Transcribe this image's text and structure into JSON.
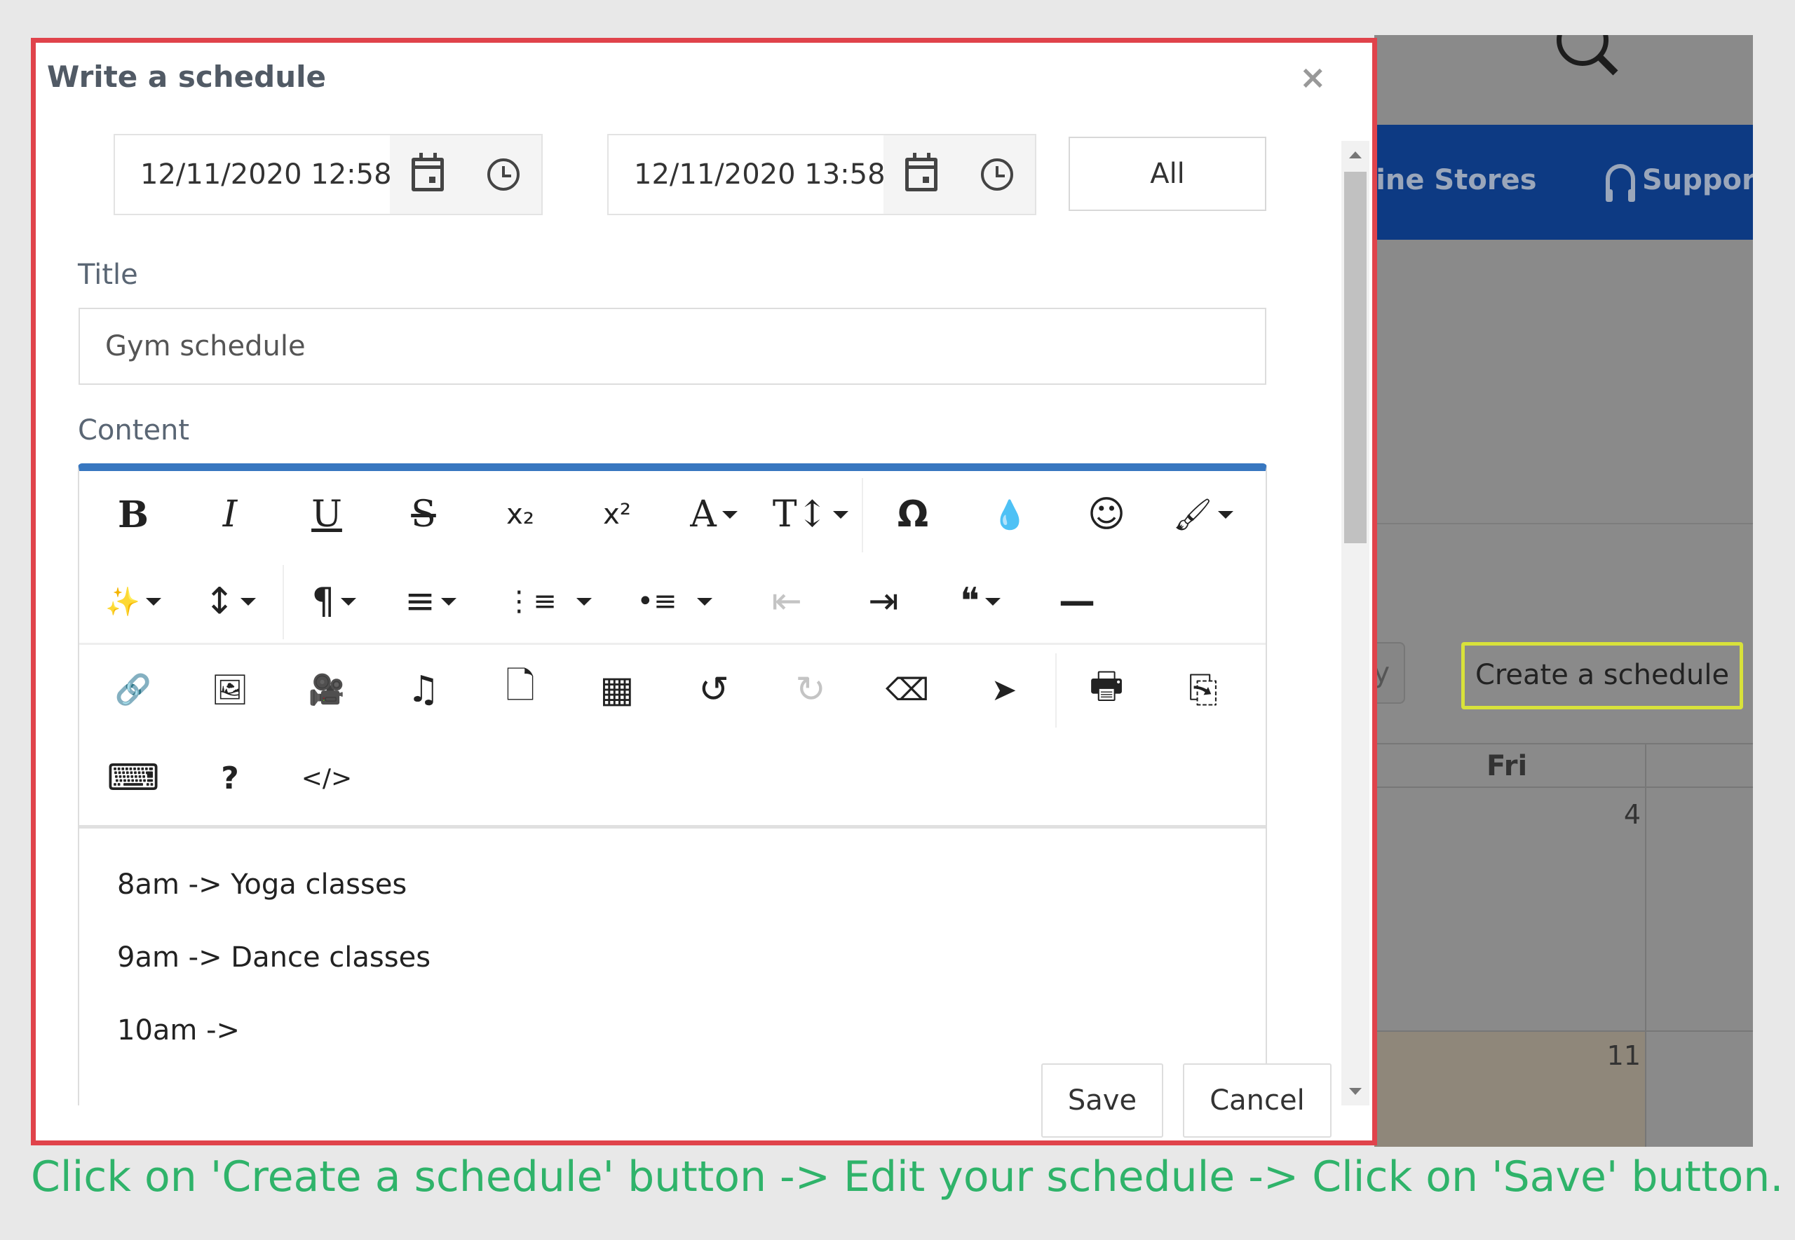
{
  "background": {
    "nav": {
      "stores": "nline Stores",
      "support": "Support"
    },
    "today_button": "lay",
    "create_button": "Create a schedule",
    "calendar": {
      "day_header": "Fri",
      "cell_a": "4",
      "cell_b": "11"
    }
  },
  "dialog": {
    "title": "Write a schedule",
    "close_label": "×",
    "start_datetime": "12/11/2020 12:58",
    "end_datetime": "12/11/2020 13:58",
    "calendar_select": "All",
    "title_label": "Title",
    "title_value": "Gym schedule",
    "content_label": "Content",
    "content_lines": [
      "8am -> Yoga classes",
      "9am -> Dance classes",
      "10am ->"
    ],
    "save_label": "Save",
    "cancel_label": "Cancel"
  },
  "toolbar": {
    "bold": "B",
    "italic": "I",
    "underline": "U",
    "strikethrough": "S",
    "subscript": "x₂",
    "superscript": "x²",
    "font_color": "A",
    "font_size": "T↕",
    "special_char": "Ω",
    "color_drop": "💧",
    "emoji": "☺",
    "paint": "🖌",
    "magic": "✨",
    "line_height": "↕",
    "paragraph": "¶",
    "align": "≡",
    "ordered_list": "⋮≡",
    "unordered_list": "•≡",
    "outdent": "⇤",
    "indent": "⇥",
    "quote": "❝",
    "hr": "—",
    "link": "🔗",
    "image": "🖼",
    "video": "🎥",
    "audio": "♫",
    "file": "🗋",
    "table": "▦",
    "undo": "↺",
    "redo": "↻",
    "eraser": "⌫",
    "select": "➤",
    "print": "🖶",
    "pdf": "⎘",
    "keyboard": "⌨",
    "help": "?",
    "code": "</>"
  },
  "caption": "Click on 'Create a schedule' button -> Edit your schedule -> Click on 'Save' button.",
  "colors": {
    "highlight_red": "#e0434b",
    "highlight_yellow": "#d8e23a",
    "editor_accent": "#3877c0",
    "caption_green": "#2fb36a"
  }
}
